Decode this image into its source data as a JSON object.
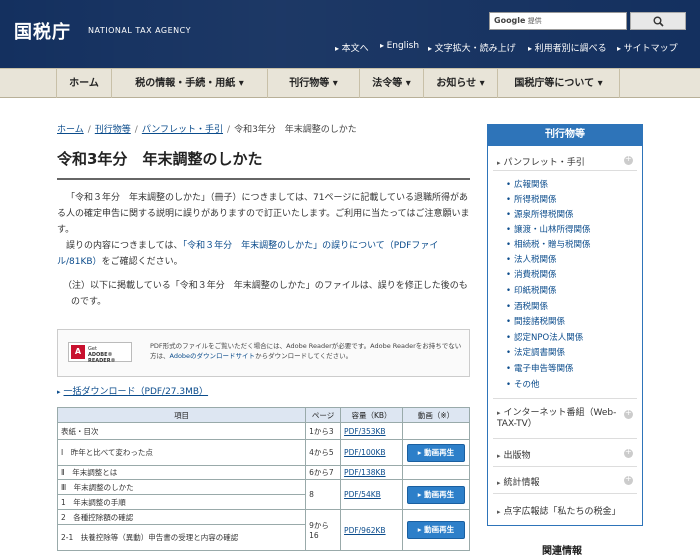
{
  "header": {
    "logo": "国税庁",
    "logo_en": "NATIONAL TAX AGENCY",
    "search_google": "Google",
    "search_placeholder": "提供",
    "util_links": [
      "本文へ",
      "English",
      "文字拡大・読み上げ",
      "利用者別に調べる",
      "サイトマップ"
    ]
  },
  "nav": [
    "ホーム",
    "税の情報・手続・用紙",
    "刊行物等",
    "法令等",
    "お知らせ",
    "国税庁等について"
  ],
  "breadcrumb": {
    "items": [
      "ホーム",
      "刊行物等",
      "パンフレット・手引"
    ],
    "current": "令和3年分　年末調整のしかた"
  },
  "page_title": "令和3年分　年末調整のしかた",
  "paragraphs": {
    "p1": "「令和３年分　年末調整のしかた」（冊子）につきましては、71ページに記載している退職所得がある人の確定申告に関する説明に誤りがありますので訂正いたします。ご利用に当たってはご注意願います。",
    "p2_pre": "誤りの内容につきましては、",
    "p2_link": "「令和３年分　年末調整のしかた」の誤りについて（PDFファイル/81KB）",
    "p2_post": "をご確認ください。",
    "p3": "（注）以下に掲載している「令和３年分　年末調整のしかた」のファイルは、誤りを修正した後のものです。"
  },
  "reader": {
    "badge_top": "Get",
    "badge_name": "ADOBE® READER®",
    "text_pre": "PDF形式のファイルをご覧いただく場合には、Adobe Readerが必要です。Adobe Readerをお持ちでない方は、",
    "text_link": "Adobeのダウンロードサイト",
    "text_post": "からダウンロードしてください。"
  },
  "download_all": "一括ダウンロード（PDF/27.3MB）",
  "table": {
    "headers": [
      "項目",
      "ページ",
      "容量（KB）",
      "動画（※）"
    ],
    "rows": [
      {
        "item": "表紙・目次",
        "page": "1から3",
        "size": "PDF/353KB",
        "video": ""
      },
      {
        "item": "Ⅰ　昨年と比べて変わった点",
        "page": "4から5",
        "size": "PDF/100KB",
        "video": "▸ 動画再生"
      },
      {
        "item": "Ⅱ　年末調整とは",
        "page": "6から7",
        "size": "PDF/138KB",
        "video": ""
      },
      {
        "item": "Ⅲ　年末調整のしかた",
        "page": "8",
        "size": "PDF/54KB",
        "video": "▸ 動画再生"
      },
      {
        "item": "1　年末調整の手順",
        "page": "",
        "size": "",
        "video": ""
      },
      {
        "item": "2　各種控除額の確認",
        "page": "9から16",
        "size": "PDF/962KB",
        "video": "▸ 動画再生"
      },
      {
        "item": "2-1　扶養控除等（異動）申告書の受理と内容の確認",
        "page": "",
        "size": "",
        "video": ""
      }
    ]
  },
  "sidebar": {
    "title": "刊行物等",
    "section1": "パンフレット・手引",
    "subitems": [
      "広報関係",
      "所得税関係",
      "源泉所得税関係",
      "譲渡・山林所得関係",
      "相続税・贈与税関係",
      "法人税関係",
      "消費税関係",
      "印紙税関係",
      "酒税関係",
      "間接諸税関係",
      "認定NPO法人関係",
      "法定調書関係",
      "電子申告等関係",
      "その他"
    ],
    "sections": [
      "インターネット番組（Web-TAX-TV）",
      "出版物",
      "統計情報",
      "点字広報誌「私たちの税金」"
    ],
    "related": "関連情報"
  }
}
